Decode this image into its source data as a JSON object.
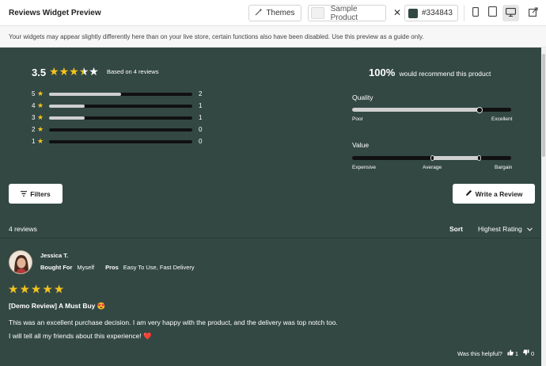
{
  "topbar": {
    "title": "Reviews Widget Preview",
    "themes_label": "Themes",
    "product_label": "Sample Product",
    "color_value": "#334843",
    "accent_color": "#334843"
  },
  "notice": "Your widgets may appear slightly differently here than on your live store, certain functions also have been disabled. Use this preview as a guide only.",
  "summary": {
    "average": "3.5",
    "average_value": 3.5,
    "based_on": "Based on 4 reviews",
    "distribution": [
      {
        "stars": "5",
        "count": "2",
        "fraction": 0.5
      },
      {
        "stars": "4",
        "count": "1",
        "fraction": 0.25
      },
      {
        "stars": "3",
        "count": "1",
        "fraction": 0.25
      },
      {
        "stars": "2",
        "count": "0",
        "fraction": 0
      },
      {
        "stars": "1",
        "count": "0",
        "fraction": 0
      }
    ],
    "recommend_percent": "100%",
    "recommend_text": "would recommend this product"
  },
  "attributes": {
    "quality": {
      "title": "Quality",
      "low": "Poor",
      "high": "Excellent",
      "level": 0.8
    },
    "value": {
      "title": "Value",
      "low": "Expensive",
      "mid": "Average",
      "high": "Bargain",
      "level_low": 0.5,
      "level_high": 0.8
    }
  },
  "actions": {
    "filters_label": "Filters",
    "write_label": "Write a Review"
  },
  "list": {
    "count_label": "4 reviews",
    "sort_label": "Sort",
    "sort_value": "Highest Rating"
  },
  "review": {
    "author": "Jessica T.",
    "bought_for_key": "Bought For",
    "bought_for_val": "Myself",
    "pros_key": "Pros",
    "pros_val": "Easy To Use, Fast Delivery",
    "rating": 5,
    "title": "[Demo Review] A Must Buy 😍",
    "body1": "This was an excellent purchase decision. I am very happy with the product, and the delivery was top notch too.",
    "body2": "I will tell all my friends about this experience! ❤️",
    "helpful_label": "Was this helpful?",
    "up_count": "1",
    "down_count": "0"
  },
  "icons": [
    "magic-wand-icon",
    "close-icon",
    "mobile-icon",
    "tablet-icon",
    "desktop-icon",
    "collapse-icon",
    "star-icon",
    "filter-icon",
    "pencil-icon",
    "chevron-down-icon",
    "thumbs-up-icon",
    "thumbs-down-icon"
  ]
}
